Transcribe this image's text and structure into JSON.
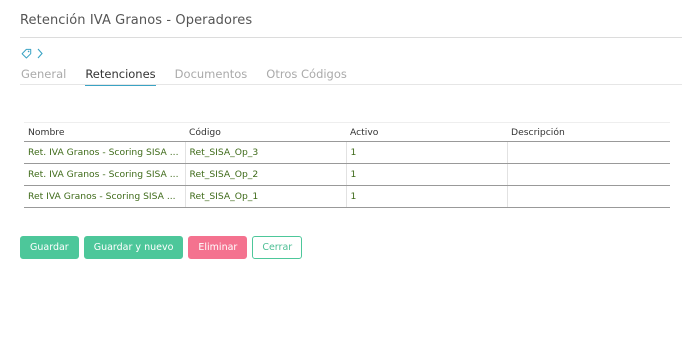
{
  "header": {
    "title": "Retención IVA Granos - Operadores"
  },
  "breadcrumb": {
    "tag_icon": "tag-icon",
    "chevron_icon": "chevron-right-icon"
  },
  "tabs": [
    {
      "label": "General",
      "active": false
    },
    {
      "label": "Retenciones",
      "active": true
    },
    {
      "label": "Documentos",
      "active": false
    },
    {
      "label": "Otros Códigos",
      "active": false
    }
  ],
  "table": {
    "columns": [
      "Nombre",
      "Código",
      "Activo",
      "Descripción"
    ],
    "rows": [
      {
        "nombre": "Ret. IVA Granos - Scoring SISA ...",
        "codigo": "Ret_SISA_Op_3",
        "activo": "1",
        "descripcion": ""
      },
      {
        "nombre": "Ret. IVA Granos - Scoring SISA ...",
        "codigo": "Ret_SISA_Op_2",
        "activo": "1",
        "descripcion": ""
      },
      {
        "nombre": "Ret IVA Granos - Scoring SISA ...",
        "codigo": "Ret_SISA_Op_1",
        "activo": "1",
        "descripcion": ""
      }
    ]
  },
  "buttons": {
    "save": "Guardar",
    "save_new": "Guardar y nuevo",
    "delete": "Eliminar",
    "close": "Cerrar"
  },
  "colors": {
    "accent_tab": "#3aa3c4",
    "button_green": "#4dc79a",
    "button_delete": "#f4728f",
    "cell_text": "#3f6b1a"
  }
}
